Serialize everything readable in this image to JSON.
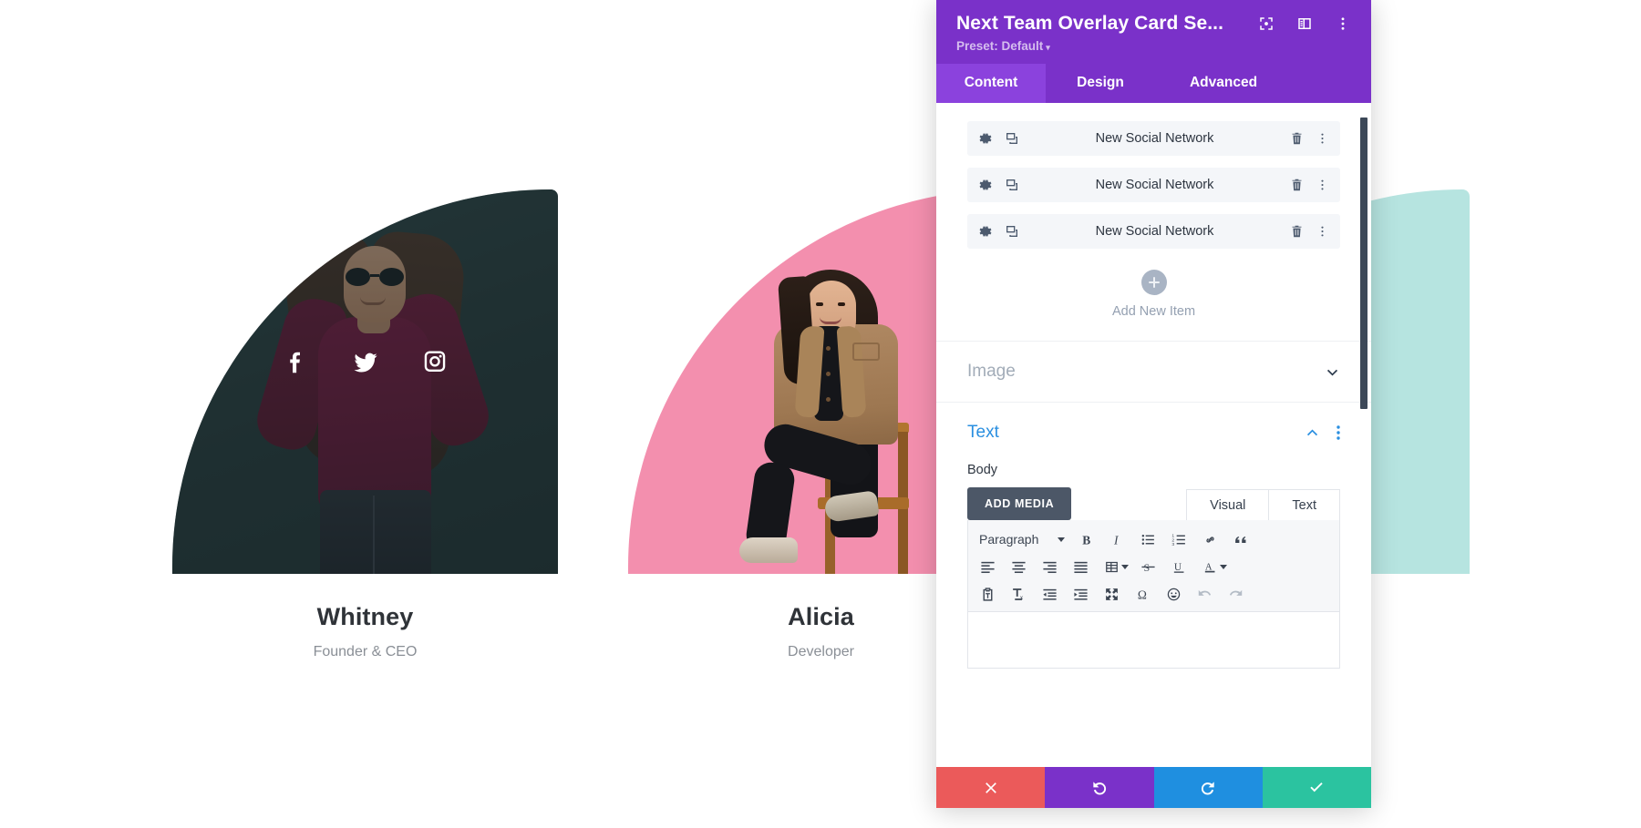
{
  "page": {
    "team_members": [
      {
        "name": "Whitney",
        "role": "Founder & CEO",
        "socials": [
          "facebook-icon",
          "twitter-icon",
          "instagram-icon"
        ]
      },
      {
        "name": "Alicia",
        "role": "Developer",
        "socials": []
      },
      {
        "name": "",
        "role": "",
        "socials": []
      }
    ],
    "colors": {
      "whitney_backdrop": "#243638",
      "alicia_backdrop": "#f38fae",
      "third_backdrop": "#b6e4e0",
      "name_text": "#2f3338",
      "role_text": "#8a8f96"
    }
  },
  "builder": {
    "header": {
      "title": "Next Team Overlay Card Se...",
      "preset_label": "Preset: Default",
      "preset_caret": "▾",
      "icons": [
        "focus-target-icon",
        "layout-panel-icon",
        "kebab-menu-icon"
      ],
      "accent": "#7a31c9",
      "accent_active": "#8b42dd"
    },
    "tabs": [
      {
        "label": "Content",
        "active": true
      },
      {
        "label": "Design",
        "active": false
      },
      {
        "label": "Advanced",
        "active": false
      }
    ],
    "social_items": [
      {
        "label": "New Social Network"
      },
      {
        "label": "New Social Network"
      },
      {
        "label": "New Social Network"
      }
    ],
    "item_icons": {
      "settings": "gear-icon",
      "duplicate": "duplicate-icon",
      "delete": "trash-icon",
      "more": "kebab-menu-icon"
    },
    "add_new": {
      "label": "Add New Item",
      "icon": "plus-icon"
    },
    "sections": [
      {
        "label": "Image",
        "open": false,
        "chevron": "chevron-down-icon"
      },
      {
        "label": "Text",
        "open": true,
        "chevron": "chevron-up-icon"
      }
    ],
    "text_section": {
      "field_label": "Body",
      "add_media_label": "ADD MEDIA",
      "editor_tabs": [
        {
          "label": "Visual",
          "active": true
        },
        {
          "label": "Text",
          "active": false
        }
      ],
      "format_select": "Paragraph",
      "toolbar_row1": [
        "bold-icon",
        "italic-icon",
        "bulleted-list-icon",
        "numbered-list-icon",
        "link-icon",
        "blockquote-icon"
      ],
      "toolbar_row2": [
        "align-left-icon",
        "align-center-icon",
        "align-right-icon",
        "align-justify-icon",
        "table-icon",
        "strikethrough-icon",
        "underline-icon",
        "text-color-icon"
      ],
      "toolbar_row3": [
        "paste-as-text-icon",
        "clear-formatting-icon",
        "outdent-icon",
        "indent-icon",
        "fullscreen-icon",
        "special-character-icon",
        "emoji-icon",
        "undo-icon",
        "redo-icon"
      ],
      "content": ""
    },
    "footer_buttons": [
      {
        "name": "cancel",
        "icon": "close-icon",
        "color": "#eb5a5a"
      },
      {
        "name": "undo",
        "icon": "undo-arrow-icon",
        "color": "#7a31c9"
      },
      {
        "name": "redo",
        "icon": "redo-arrow-icon",
        "color": "#1f8fe0"
      },
      {
        "name": "save",
        "icon": "check-icon",
        "color": "#2bc3a0"
      }
    ]
  }
}
